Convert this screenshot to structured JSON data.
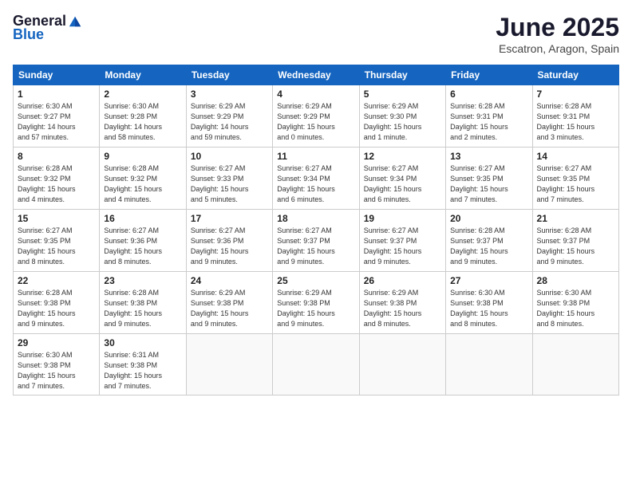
{
  "logo": {
    "general": "General",
    "blue": "Blue"
  },
  "header": {
    "title": "June 2025",
    "subtitle": "Escatron, Aragon, Spain"
  },
  "columns": [
    "Sunday",
    "Monday",
    "Tuesday",
    "Wednesday",
    "Thursday",
    "Friday",
    "Saturday"
  ],
  "weeks": [
    [
      {
        "day": "1",
        "info": "Sunrise: 6:30 AM\nSunset: 9:27 PM\nDaylight: 14 hours\nand 57 minutes."
      },
      {
        "day": "2",
        "info": "Sunrise: 6:30 AM\nSunset: 9:28 PM\nDaylight: 14 hours\nand 58 minutes."
      },
      {
        "day": "3",
        "info": "Sunrise: 6:29 AM\nSunset: 9:29 PM\nDaylight: 14 hours\nand 59 minutes."
      },
      {
        "day": "4",
        "info": "Sunrise: 6:29 AM\nSunset: 9:29 PM\nDaylight: 15 hours\nand 0 minutes."
      },
      {
        "day": "5",
        "info": "Sunrise: 6:29 AM\nSunset: 9:30 PM\nDaylight: 15 hours\nand 1 minute."
      },
      {
        "day": "6",
        "info": "Sunrise: 6:28 AM\nSunset: 9:31 PM\nDaylight: 15 hours\nand 2 minutes."
      },
      {
        "day": "7",
        "info": "Sunrise: 6:28 AM\nSunset: 9:31 PM\nDaylight: 15 hours\nand 3 minutes."
      }
    ],
    [
      {
        "day": "8",
        "info": "Sunrise: 6:28 AM\nSunset: 9:32 PM\nDaylight: 15 hours\nand 4 minutes."
      },
      {
        "day": "9",
        "info": "Sunrise: 6:28 AM\nSunset: 9:32 PM\nDaylight: 15 hours\nand 4 minutes."
      },
      {
        "day": "10",
        "info": "Sunrise: 6:27 AM\nSunset: 9:33 PM\nDaylight: 15 hours\nand 5 minutes."
      },
      {
        "day": "11",
        "info": "Sunrise: 6:27 AM\nSunset: 9:34 PM\nDaylight: 15 hours\nand 6 minutes."
      },
      {
        "day": "12",
        "info": "Sunrise: 6:27 AM\nSunset: 9:34 PM\nDaylight: 15 hours\nand 6 minutes."
      },
      {
        "day": "13",
        "info": "Sunrise: 6:27 AM\nSunset: 9:35 PM\nDaylight: 15 hours\nand 7 minutes."
      },
      {
        "day": "14",
        "info": "Sunrise: 6:27 AM\nSunset: 9:35 PM\nDaylight: 15 hours\nand 7 minutes."
      }
    ],
    [
      {
        "day": "15",
        "info": "Sunrise: 6:27 AM\nSunset: 9:35 PM\nDaylight: 15 hours\nand 8 minutes."
      },
      {
        "day": "16",
        "info": "Sunrise: 6:27 AM\nSunset: 9:36 PM\nDaylight: 15 hours\nand 8 minutes."
      },
      {
        "day": "17",
        "info": "Sunrise: 6:27 AM\nSunset: 9:36 PM\nDaylight: 15 hours\nand 9 minutes."
      },
      {
        "day": "18",
        "info": "Sunrise: 6:27 AM\nSunset: 9:37 PM\nDaylight: 15 hours\nand 9 minutes."
      },
      {
        "day": "19",
        "info": "Sunrise: 6:27 AM\nSunset: 9:37 PM\nDaylight: 15 hours\nand 9 minutes."
      },
      {
        "day": "20",
        "info": "Sunrise: 6:28 AM\nSunset: 9:37 PM\nDaylight: 15 hours\nand 9 minutes."
      },
      {
        "day": "21",
        "info": "Sunrise: 6:28 AM\nSunset: 9:37 PM\nDaylight: 15 hours\nand 9 minutes."
      }
    ],
    [
      {
        "day": "22",
        "info": "Sunrise: 6:28 AM\nSunset: 9:38 PM\nDaylight: 15 hours\nand 9 minutes."
      },
      {
        "day": "23",
        "info": "Sunrise: 6:28 AM\nSunset: 9:38 PM\nDaylight: 15 hours\nand 9 minutes."
      },
      {
        "day": "24",
        "info": "Sunrise: 6:29 AM\nSunset: 9:38 PM\nDaylight: 15 hours\nand 9 minutes."
      },
      {
        "day": "25",
        "info": "Sunrise: 6:29 AM\nSunset: 9:38 PM\nDaylight: 15 hours\nand 9 minutes."
      },
      {
        "day": "26",
        "info": "Sunrise: 6:29 AM\nSunset: 9:38 PM\nDaylight: 15 hours\nand 8 minutes."
      },
      {
        "day": "27",
        "info": "Sunrise: 6:30 AM\nSunset: 9:38 PM\nDaylight: 15 hours\nand 8 minutes."
      },
      {
        "day": "28",
        "info": "Sunrise: 6:30 AM\nSunset: 9:38 PM\nDaylight: 15 hours\nand 8 minutes."
      }
    ],
    [
      {
        "day": "29",
        "info": "Sunrise: 6:30 AM\nSunset: 9:38 PM\nDaylight: 15 hours\nand 7 minutes."
      },
      {
        "day": "30",
        "info": "Sunrise: 6:31 AM\nSunset: 9:38 PM\nDaylight: 15 hours\nand 7 minutes."
      },
      {
        "day": "",
        "info": ""
      },
      {
        "day": "",
        "info": ""
      },
      {
        "day": "",
        "info": ""
      },
      {
        "day": "",
        "info": ""
      },
      {
        "day": "",
        "info": ""
      }
    ]
  ]
}
